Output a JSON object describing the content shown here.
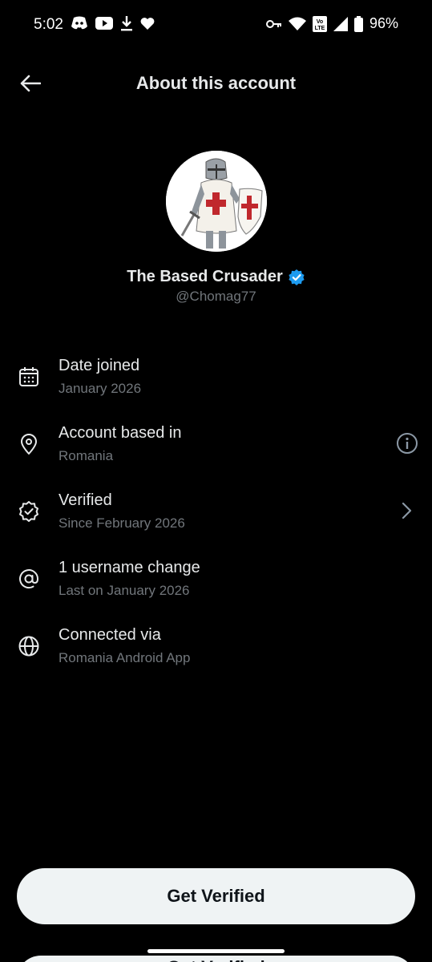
{
  "status_bar": {
    "time": "5:02",
    "battery": "96%",
    "network_badge": "Vo LTE",
    "left_icons": [
      "discord-icon",
      "youtube-icon",
      "download-icon",
      "heart-icon"
    ],
    "right_icons": [
      "vpn-key-icon",
      "wifi-icon",
      "volte-icon",
      "signal-icon",
      "battery-icon"
    ]
  },
  "header": {
    "title": "About this account"
  },
  "profile": {
    "display_name": "The Based Crusader",
    "handle": "@Chomag77",
    "verified_badge_color": "#1d9bf0"
  },
  "info_rows": [
    {
      "icon": "calendar-icon",
      "label": "Date joined",
      "sub": "January 2026",
      "trailing": null
    },
    {
      "icon": "location-pin-icon",
      "label": "Account based in",
      "sub": "Romania",
      "trailing": "info-icon"
    },
    {
      "icon": "verified-badge-icon",
      "label": "Verified",
      "sub": "Since February 2026",
      "trailing": "chevron-right-icon"
    },
    {
      "icon": "at-sign-icon",
      "label": "1 username change",
      "sub": "Last on January 2026",
      "trailing": null
    },
    {
      "icon": "globe-icon",
      "label": "Connected via",
      "sub": "Romania Android App",
      "trailing": null
    }
  ],
  "actions": {
    "get_verified_label": "Get Verified"
  },
  "colors": {
    "background": "#000000",
    "primary_text": "#e7e9ea",
    "secondary_text": "#71767b",
    "button_bg": "#eff3f4",
    "button_text": "#0f1419",
    "accent": "#1d9bf0"
  }
}
